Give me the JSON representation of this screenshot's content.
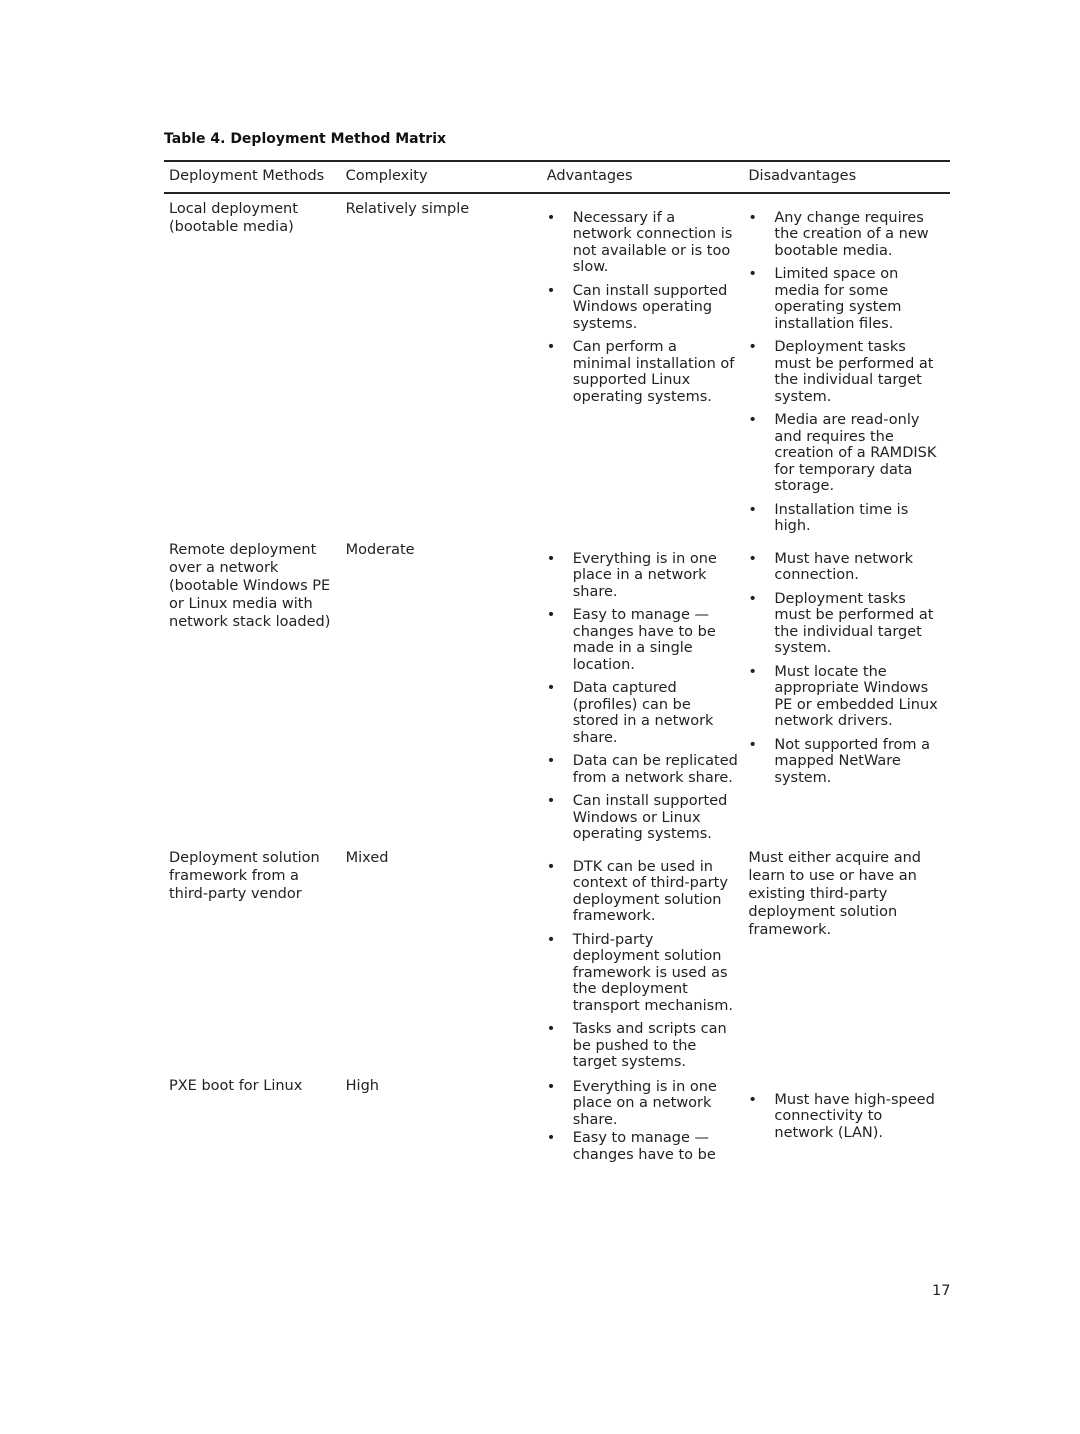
{
  "caption": "Table 4. Deployment Method Matrix",
  "headers": [
    "Deployment Methods",
    "Complexity",
    "Advantages",
    "Disadvantages"
  ],
  "bullet": "•",
  "rows": [
    {
      "method": "Local deployment (bootable media)",
      "complexity": "Relatively simple",
      "advantages": [
        "Necessary if a network connection is not available or is too slow.",
        "Can install supported Windows operating systems.",
        "Can perform a minimal installation of supported Linux operating systems."
      ],
      "disadvantages": [
        "Any change requires the creation of a new bootable media.",
        "Limited space on media for some operating system installation files.",
        "Deployment tasks must be performed at the individual target system.",
        "Media are read-only and requires the creation of a RAMDISK for temporary data storage.",
        "Installation time is high."
      ]
    },
    {
      "method": "Remote deployment over a network (bootable Windows PE or Linux media with network stack loaded)",
      "complexity": "Moderate",
      "advantages": [
        "Everything is in one place in a network share.",
        "Easy to manage — changes have to be made in a single location.",
        "Data captured (profiles) can be stored in a network share.",
        "Data can be replicated from a network share.",
        "Can install supported Windows or Linux operating systems."
      ],
      "disadvantages": [
        "Must have network connection.",
        "Deployment tasks must be performed at the individual target system.",
        "Must locate the appropriate Windows PE or embedded Linux network drivers.",
        "Not supported from a mapped NetWare system."
      ]
    },
    {
      "method": "Deployment solution framework from a third-party vendor",
      "complexity": "Mixed",
      "advantages": [
        "DTK can be used in context of third-party deployment solution framework.",
        "Third-party deployment solution framework is used as the deployment transport mechanism.",
        "Tasks and scripts can be pushed to the target systems."
      ],
      "disadvantages_text": "Must either acquire and learn to use or have an existing third-party deployment solution framework."
    },
    {
      "method": "PXE boot for Linux",
      "complexity": "High",
      "advantages": [
        "Everything is in one place on a network share.",
        "Easy to manage — changes have to be"
      ],
      "disadvantages": [
        "Must have high-speed connectivity to network (LAN)."
      ]
    }
  ],
  "page_number": "17"
}
